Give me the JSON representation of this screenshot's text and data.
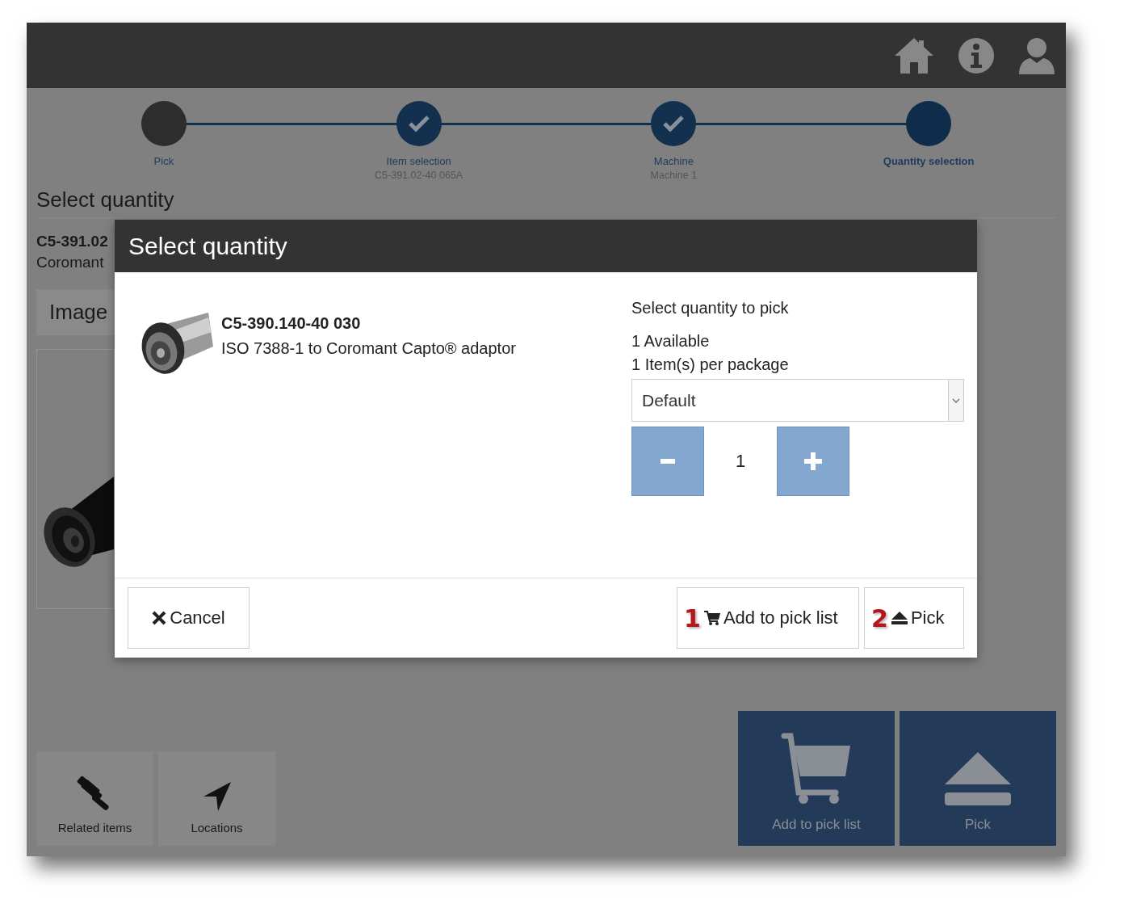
{
  "steps": [
    {
      "label": "Pick",
      "completed": false,
      "selected": false
    },
    {
      "label": "Item selection",
      "detail": "C5-391.02-40 065A",
      "completed": true,
      "selected": false
    },
    {
      "label": "Machine",
      "detail": "Machine 1",
      "completed": true,
      "selected": false
    },
    {
      "label": "Quantity selection",
      "completed": false,
      "selected": true
    }
  ],
  "page": {
    "title": "Select quantity",
    "item_code": "C5-391.02",
    "item_name": "Coromant",
    "image_tab": "Image"
  },
  "tools": [
    {
      "label": "Related items",
      "kind": "related"
    },
    {
      "label": "Locations",
      "kind": "locations"
    }
  ],
  "actions": [
    {
      "label": "Add to pick list",
      "kind": "cart"
    },
    {
      "label": "Pick",
      "kind": "eject"
    }
  ],
  "dialog": {
    "title": "Select quantity",
    "product": {
      "code": "C5-390.140-40 030",
      "description": "ISO 7388-1 to Coromant Capto® adaptor"
    },
    "quantity_heading": "Select quantity to pick",
    "available": "1 Available",
    "per_package": "1 Item(s) per package",
    "package_select": {
      "value": "Default"
    },
    "quantity": "1",
    "buttons": [
      {
        "label": "Cancel",
        "kind": "cancel"
      },
      {
        "label": "Add to pick list",
        "kind": "cart",
        "callout": "1"
      },
      {
        "label": "Pick",
        "kind": "eject",
        "callout": "2"
      }
    ]
  }
}
